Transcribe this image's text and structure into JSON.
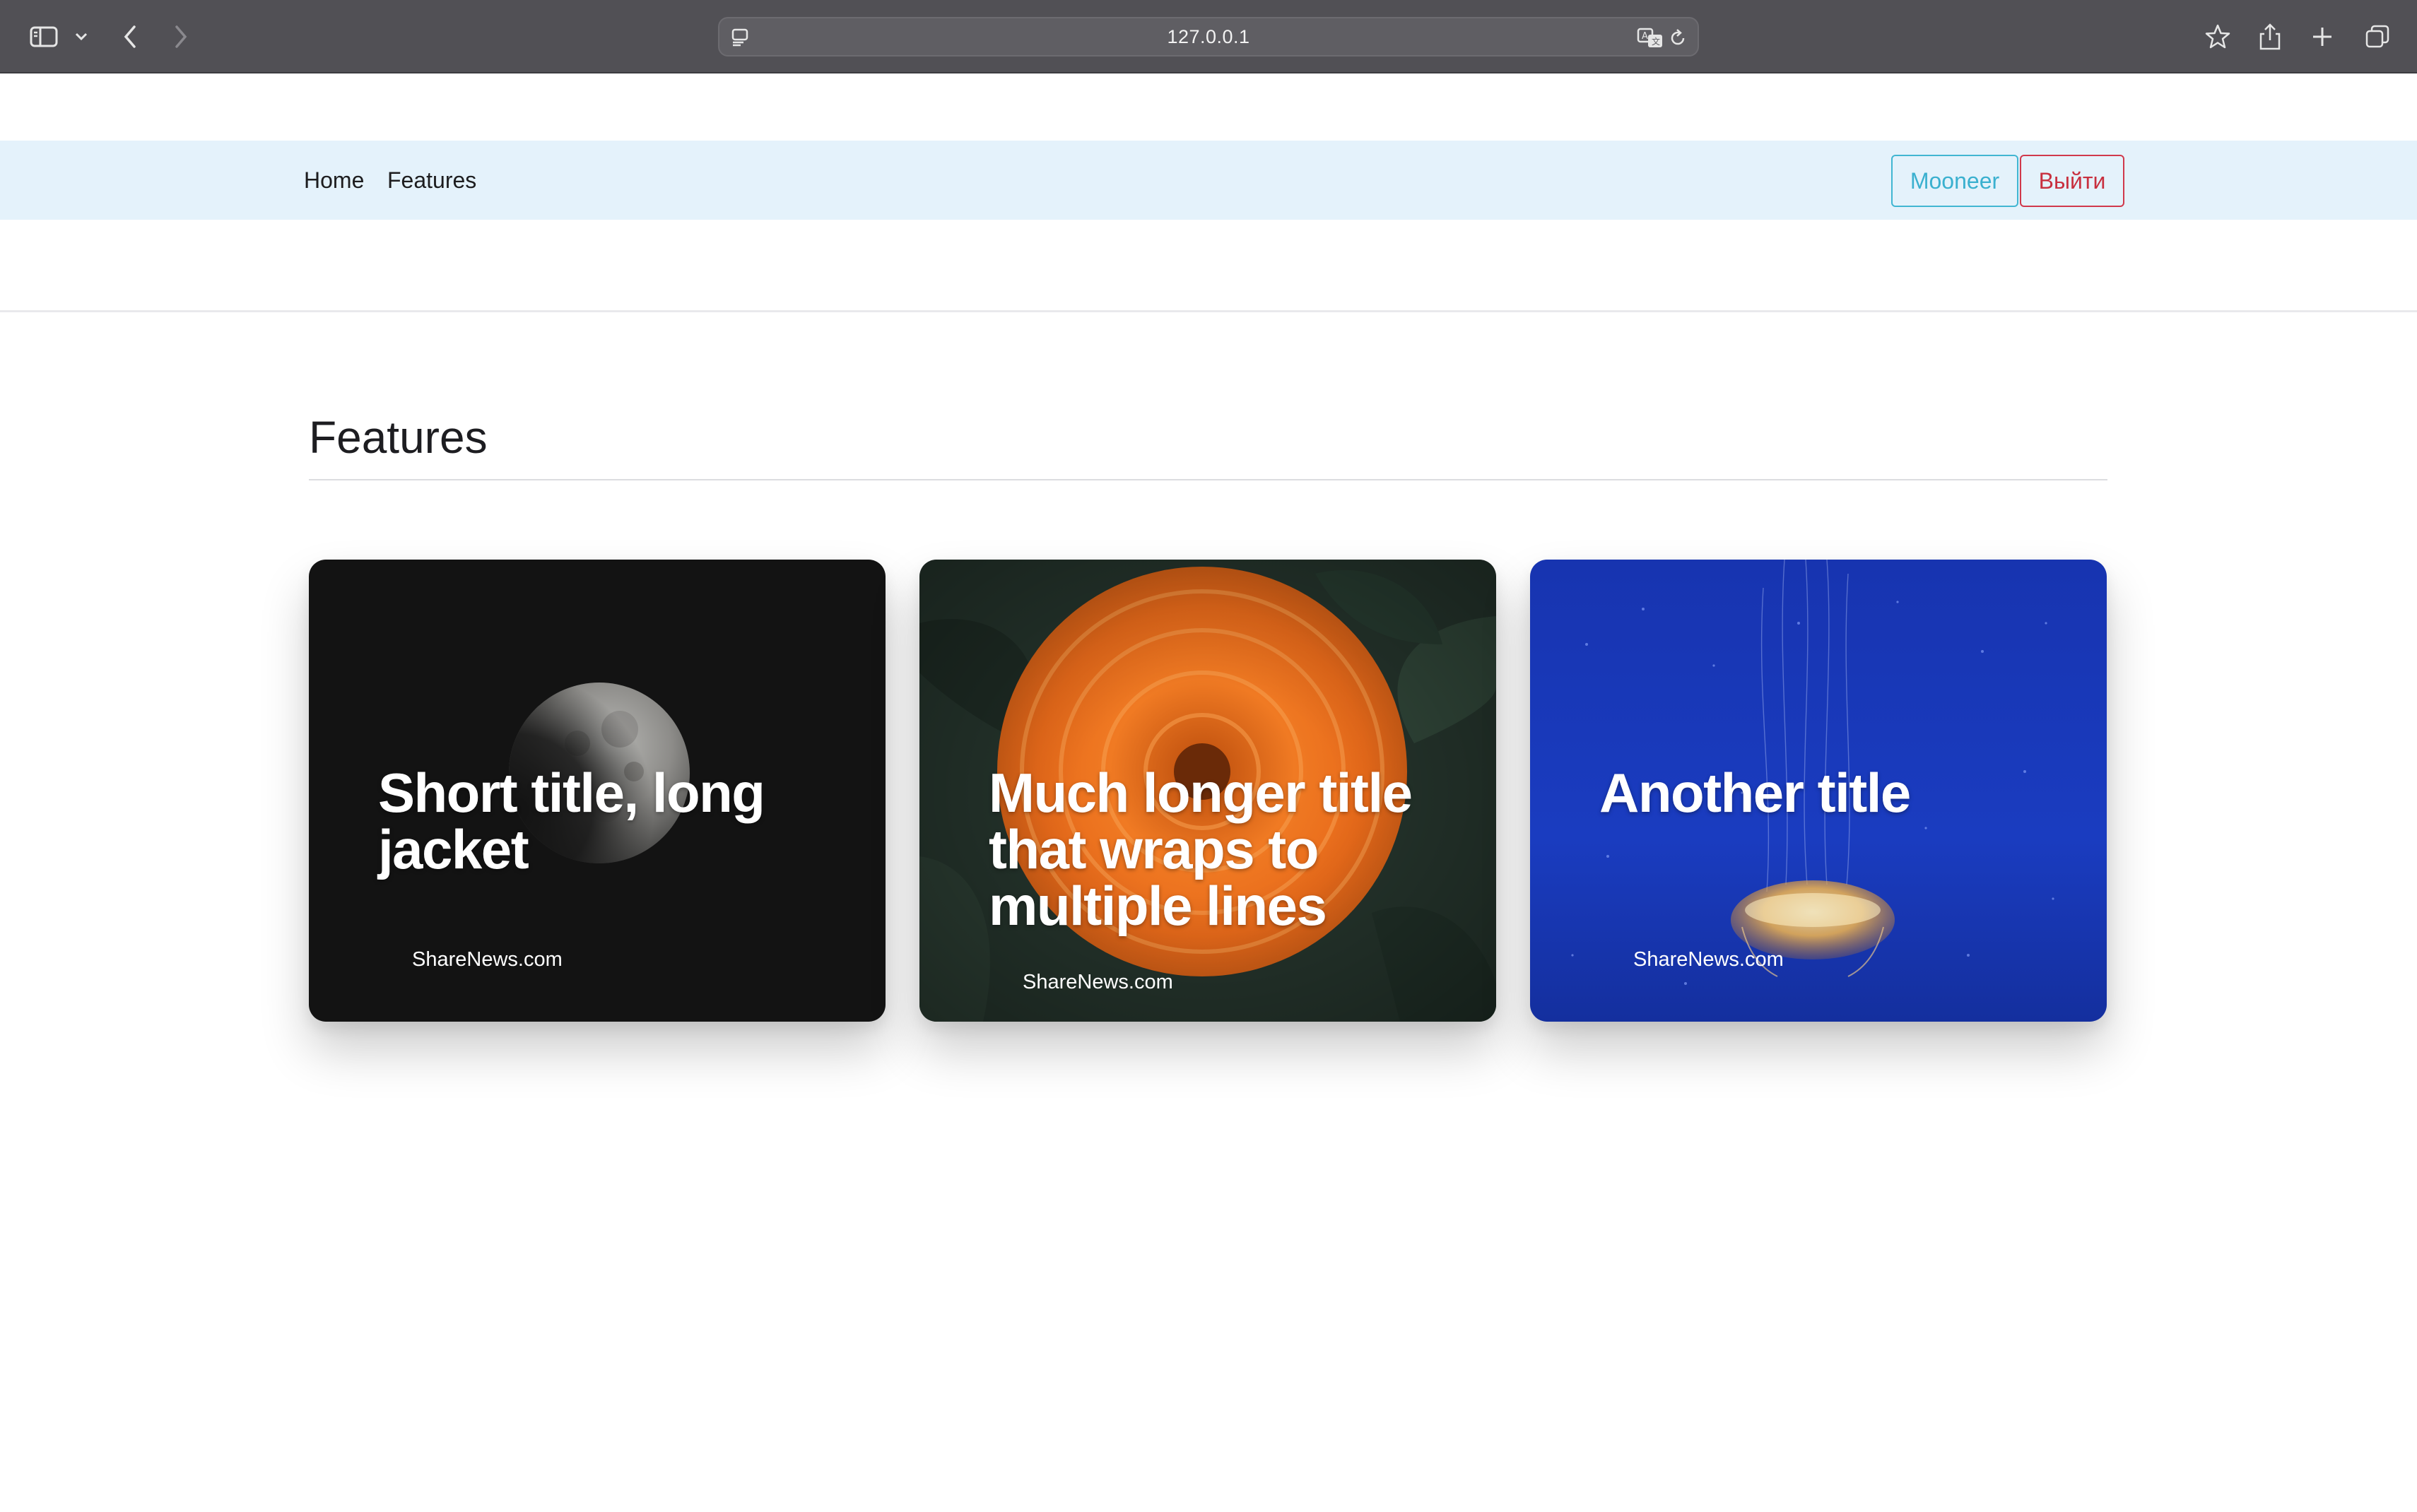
{
  "browser": {
    "url": "127.0.0.1",
    "icons": [
      "sidebar-icon",
      "chevron-down-icon",
      "back-icon",
      "forward-icon",
      "site-settings-icon",
      "translate-icon",
      "reload-icon",
      "bookmark-star-icon",
      "share-icon",
      "new-tab-icon",
      "tab-overview-icon"
    ]
  },
  "navbar": {
    "links": [
      "Home",
      "Features"
    ],
    "user_button": "Mooneer",
    "logout_button": "Выйти"
  },
  "main": {
    "heading": "Features",
    "cards": [
      {
        "title": "Short title, long jacket",
        "source": "ShareNews.com",
        "image": "moon"
      },
      {
        "title": "Much longer title that wraps to multiple lines",
        "source": "ShareNews.com",
        "image": "orange-flower"
      },
      {
        "title": "Another title",
        "source": "ShareNews.com",
        "image": "jellyfish"
      }
    ]
  },
  "colors": {
    "navbar_bg": "#e4f2fb",
    "user_button": "#3ab0cf",
    "logout_button": "#c8303f",
    "card_moon_bg": "#131313",
    "card_jelly_bg": "#1a3cc0"
  }
}
